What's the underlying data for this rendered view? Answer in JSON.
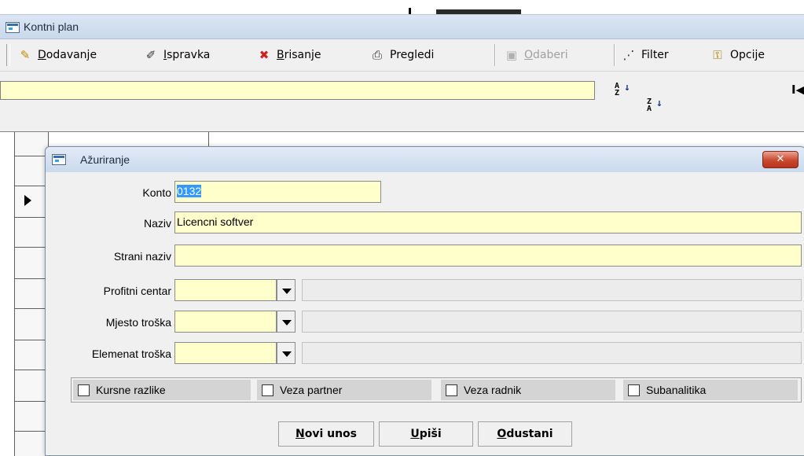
{
  "window": {
    "title": "Kontni plan"
  },
  "toolbar": {
    "add": {
      "underline": "D",
      "rest": "odavanje",
      "icon": "pencil-add-icon"
    },
    "edit": {
      "underline": "I",
      "rest": "spravka",
      "icon": "edit-icon"
    },
    "delete": {
      "underline": "B",
      "rest": "risanje",
      "icon": "delete-icon"
    },
    "views": {
      "label": "Pregledi",
      "icon": "printer-icon"
    },
    "select": {
      "underline": "O",
      "rest": "daberi",
      "icon": "select-icon",
      "disabled": true
    },
    "filter": {
      "label": "Filter",
      "icon": "filter-icon"
    },
    "options": {
      "label": "Opcije",
      "icon": "options-icon"
    }
  },
  "filterbar": {
    "value": ""
  },
  "sort": {
    "asc_top": "A",
    "asc_bottom": "Z",
    "desc_top": "Z",
    "desc_bottom": "A"
  },
  "nav": {
    "first_glyph": "I◀"
  },
  "dialog": {
    "title": "Ažuriranje",
    "close_glyph": "✕",
    "fields": {
      "konto_label": "Konto",
      "konto_value": "0132",
      "naziv_label": "Naziv",
      "naziv_value": "Licencni softver",
      "strani_naziv_label": "Strani naziv",
      "strani_naziv_value": "",
      "profitni_centar_label": "Profitni centar",
      "mjesto_troska_label": "Mjesto troška",
      "elemenat_troska_label": "Elemenat troška"
    },
    "checkboxes": {
      "kursne_razlike": {
        "label": "Kursne razlike",
        "checked": false
      },
      "veza_partner": {
        "label": "Veza partner",
        "checked": false
      },
      "veza_radnik": {
        "label": "Veza radnik",
        "checked": false
      },
      "subanalitika": {
        "label": "Subanalitika",
        "checked": false
      }
    },
    "buttons": {
      "novi_unos": {
        "underline": "N",
        "rest": "ovi unos"
      },
      "upisi": {
        "underline": "U",
        "rest": "piši"
      },
      "odustani": {
        "underline": "O",
        "rest": "dustani"
      }
    }
  },
  "colors": {
    "field_bg": "#ffffcc",
    "selection": "#3399ff",
    "close_btn": "#c9482e"
  }
}
